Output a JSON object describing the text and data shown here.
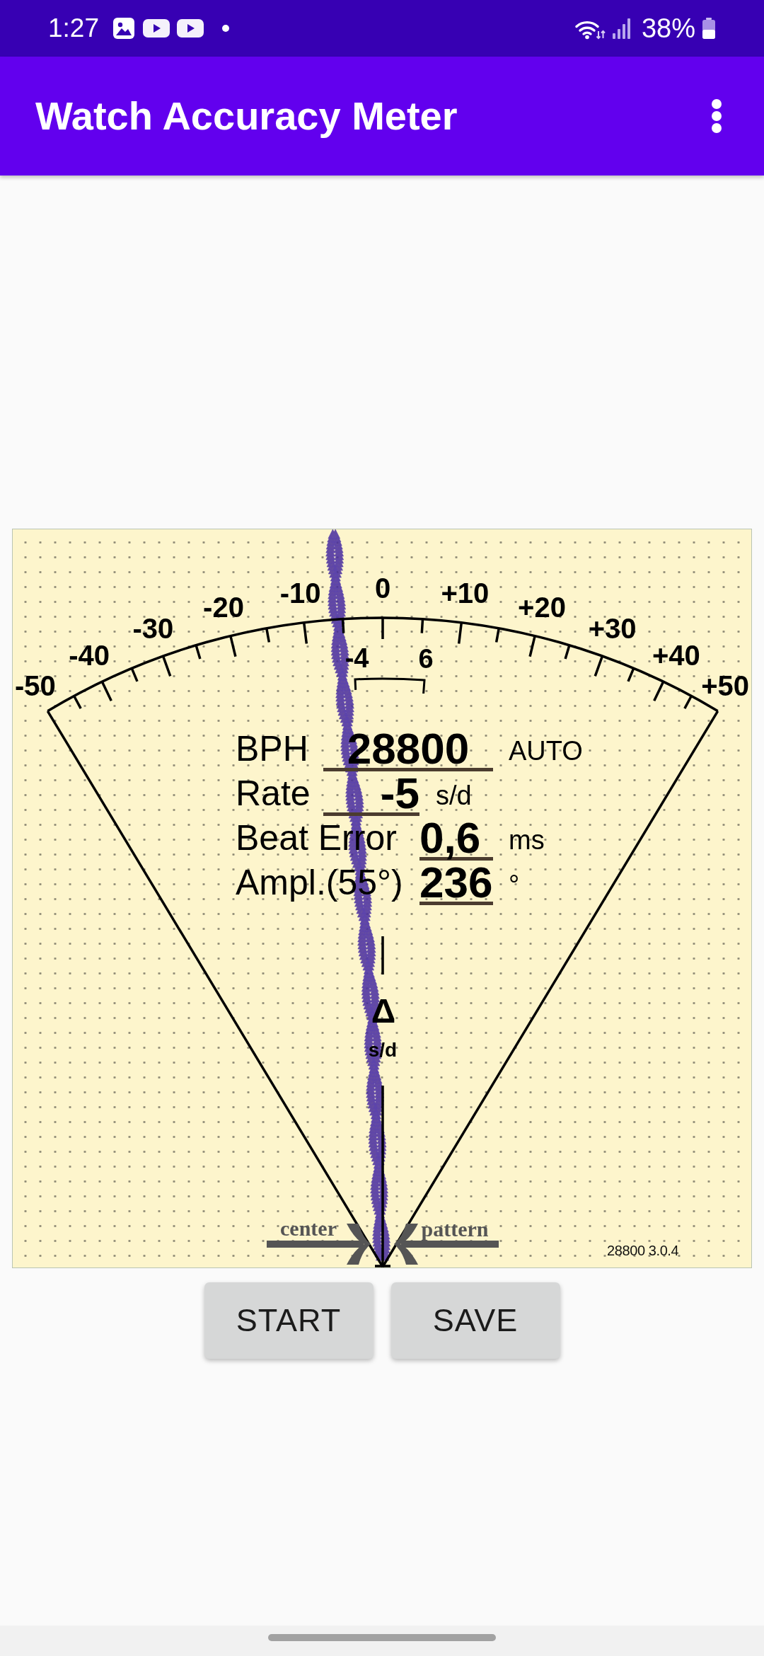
{
  "status_bar": {
    "time": "1:27",
    "battery": "38%"
  },
  "app_bar": {
    "title": "Watch Accuracy Meter"
  },
  "meter": {
    "scale_labels": [
      "-50",
      "-40",
      "-30",
      "-20",
      "-10",
      "0",
      "+10",
      "+20",
      "+30",
      "+40",
      "+50"
    ],
    "range_low": "-4",
    "range_high": "6",
    "readings": [
      {
        "label": "BPH",
        "value": "28800",
        "unit": "AUTO"
      },
      {
        "label": "Rate",
        "value": "-5",
        "unit": "s/d"
      },
      {
        "label": "Beat Error",
        "value": "0,6",
        "unit": "ms"
      },
      {
        "label": "Ampl.(55°)",
        "value": "236",
        "unit": "°"
      }
    ],
    "axis_symbol": "Δ",
    "axis_unit": "s/d",
    "center_label": "center",
    "pattern_label": "pattern",
    "version": "28800 3.0.4"
  },
  "buttons": [
    "START",
    "SAVE"
  ]
}
